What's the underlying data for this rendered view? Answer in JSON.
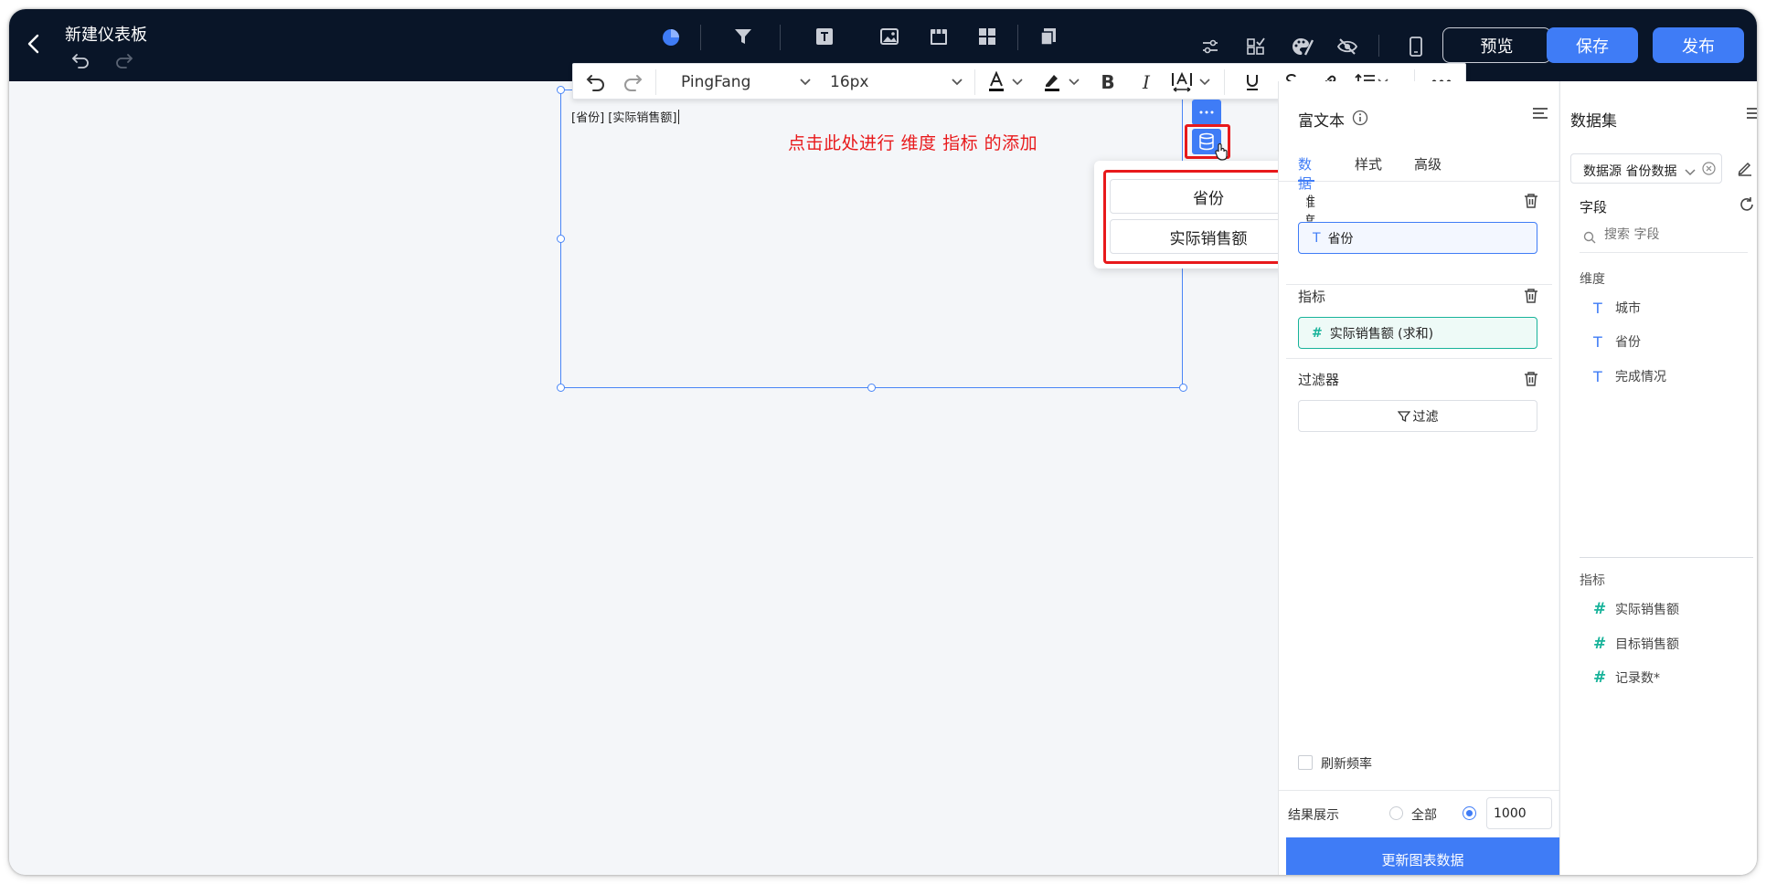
{
  "header": {
    "title": "新建仪表板",
    "preview_label": "预览",
    "save_label": "保存",
    "publish_label": "发布"
  },
  "toolbar": {
    "font_family": "PingFang",
    "font_size": "16px"
  },
  "editor": {
    "content": "[省份] [实际销售额]",
    "annotation": "点击此处进行 维度 指标 的添加"
  },
  "popup": {
    "items": [
      "省份",
      "实际销售额"
    ]
  },
  "panel": {
    "title": "富文本",
    "tabs": [
      "数据",
      "样式",
      "高级"
    ],
    "dimension_label": "维度",
    "dimension_chip": "省份",
    "metric_label": "指标",
    "metric_chip": "实际销售额 (求和)",
    "filter_label": "过滤器",
    "filter_button": "过滤",
    "refresh_label": "刷新频率",
    "result_label": "结果展示",
    "result_all": "全部",
    "result_count": "1000",
    "update_button": "更新图表数据"
  },
  "dataset": {
    "title": "数据集",
    "source": "数据源 省份数据",
    "fields_label": "字段",
    "search_placeholder": "搜索 字段",
    "dimension_group": "维度",
    "dimensions": [
      "城市",
      "省份",
      "完成情况"
    ],
    "metric_group": "指标",
    "metrics": [
      "实际销售额",
      "目标销售额",
      "记录数*"
    ]
  },
  "colors": {
    "header_bg": "#091528",
    "accent": "#3f7cf6",
    "highlight": "#e8191b",
    "metric_green": "#18b39a"
  }
}
